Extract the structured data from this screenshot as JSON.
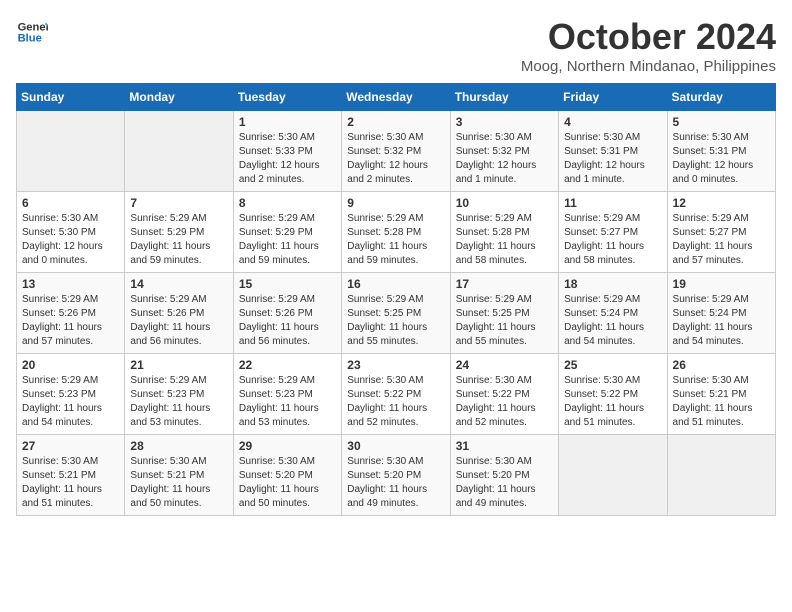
{
  "logo": {
    "line1": "General",
    "line2": "Blue"
  },
  "title": "October 2024",
  "location": "Moog, Northern Mindanao, Philippines",
  "weekdays": [
    "Sunday",
    "Monday",
    "Tuesday",
    "Wednesday",
    "Thursday",
    "Friday",
    "Saturday"
  ],
  "weeks": [
    [
      {
        "day": "",
        "info": ""
      },
      {
        "day": "",
        "info": ""
      },
      {
        "day": "1",
        "info": "Sunrise: 5:30 AM\nSunset: 5:33 PM\nDaylight: 12 hours\nand 2 minutes."
      },
      {
        "day": "2",
        "info": "Sunrise: 5:30 AM\nSunset: 5:32 PM\nDaylight: 12 hours\nand 2 minutes."
      },
      {
        "day": "3",
        "info": "Sunrise: 5:30 AM\nSunset: 5:32 PM\nDaylight: 12 hours\nand 1 minute."
      },
      {
        "day": "4",
        "info": "Sunrise: 5:30 AM\nSunset: 5:31 PM\nDaylight: 12 hours\nand 1 minute."
      },
      {
        "day": "5",
        "info": "Sunrise: 5:30 AM\nSunset: 5:31 PM\nDaylight: 12 hours\nand 0 minutes."
      }
    ],
    [
      {
        "day": "6",
        "info": "Sunrise: 5:30 AM\nSunset: 5:30 PM\nDaylight: 12 hours\nand 0 minutes."
      },
      {
        "day": "7",
        "info": "Sunrise: 5:29 AM\nSunset: 5:29 PM\nDaylight: 11 hours\nand 59 minutes."
      },
      {
        "day": "8",
        "info": "Sunrise: 5:29 AM\nSunset: 5:29 PM\nDaylight: 11 hours\nand 59 minutes."
      },
      {
        "day": "9",
        "info": "Sunrise: 5:29 AM\nSunset: 5:28 PM\nDaylight: 11 hours\nand 59 minutes."
      },
      {
        "day": "10",
        "info": "Sunrise: 5:29 AM\nSunset: 5:28 PM\nDaylight: 11 hours\nand 58 minutes."
      },
      {
        "day": "11",
        "info": "Sunrise: 5:29 AM\nSunset: 5:27 PM\nDaylight: 11 hours\nand 58 minutes."
      },
      {
        "day": "12",
        "info": "Sunrise: 5:29 AM\nSunset: 5:27 PM\nDaylight: 11 hours\nand 57 minutes."
      }
    ],
    [
      {
        "day": "13",
        "info": "Sunrise: 5:29 AM\nSunset: 5:26 PM\nDaylight: 11 hours\nand 57 minutes."
      },
      {
        "day": "14",
        "info": "Sunrise: 5:29 AM\nSunset: 5:26 PM\nDaylight: 11 hours\nand 56 minutes."
      },
      {
        "day": "15",
        "info": "Sunrise: 5:29 AM\nSunset: 5:26 PM\nDaylight: 11 hours\nand 56 minutes."
      },
      {
        "day": "16",
        "info": "Sunrise: 5:29 AM\nSunset: 5:25 PM\nDaylight: 11 hours\nand 55 minutes."
      },
      {
        "day": "17",
        "info": "Sunrise: 5:29 AM\nSunset: 5:25 PM\nDaylight: 11 hours\nand 55 minutes."
      },
      {
        "day": "18",
        "info": "Sunrise: 5:29 AM\nSunset: 5:24 PM\nDaylight: 11 hours\nand 54 minutes."
      },
      {
        "day": "19",
        "info": "Sunrise: 5:29 AM\nSunset: 5:24 PM\nDaylight: 11 hours\nand 54 minutes."
      }
    ],
    [
      {
        "day": "20",
        "info": "Sunrise: 5:29 AM\nSunset: 5:23 PM\nDaylight: 11 hours\nand 54 minutes."
      },
      {
        "day": "21",
        "info": "Sunrise: 5:29 AM\nSunset: 5:23 PM\nDaylight: 11 hours\nand 53 minutes."
      },
      {
        "day": "22",
        "info": "Sunrise: 5:29 AM\nSunset: 5:23 PM\nDaylight: 11 hours\nand 53 minutes."
      },
      {
        "day": "23",
        "info": "Sunrise: 5:30 AM\nSunset: 5:22 PM\nDaylight: 11 hours\nand 52 minutes."
      },
      {
        "day": "24",
        "info": "Sunrise: 5:30 AM\nSunset: 5:22 PM\nDaylight: 11 hours\nand 52 minutes."
      },
      {
        "day": "25",
        "info": "Sunrise: 5:30 AM\nSunset: 5:22 PM\nDaylight: 11 hours\nand 51 minutes."
      },
      {
        "day": "26",
        "info": "Sunrise: 5:30 AM\nSunset: 5:21 PM\nDaylight: 11 hours\nand 51 minutes."
      }
    ],
    [
      {
        "day": "27",
        "info": "Sunrise: 5:30 AM\nSunset: 5:21 PM\nDaylight: 11 hours\nand 51 minutes."
      },
      {
        "day": "28",
        "info": "Sunrise: 5:30 AM\nSunset: 5:21 PM\nDaylight: 11 hours\nand 50 minutes."
      },
      {
        "day": "29",
        "info": "Sunrise: 5:30 AM\nSunset: 5:20 PM\nDaylight: 11 hours\nand 50 minutes."
      },
      {
        "day": "30",
        "info": "Sunrise: 5:30 AM\nSunset: 5:20 PM\nDaylight: 11 hours\nand 49 minutes."
      },
      {
        "day": "31",
        "info": "Sunrise: 5:30 AM\nSunset: 5:20 PM\nDaylight: 11 hours\nand 49 minutes."
      },
      {
        "day": "",
        "info": ""
      },
      {
        "day": "",
        "info": ""
      }
    ]
  ]
}
